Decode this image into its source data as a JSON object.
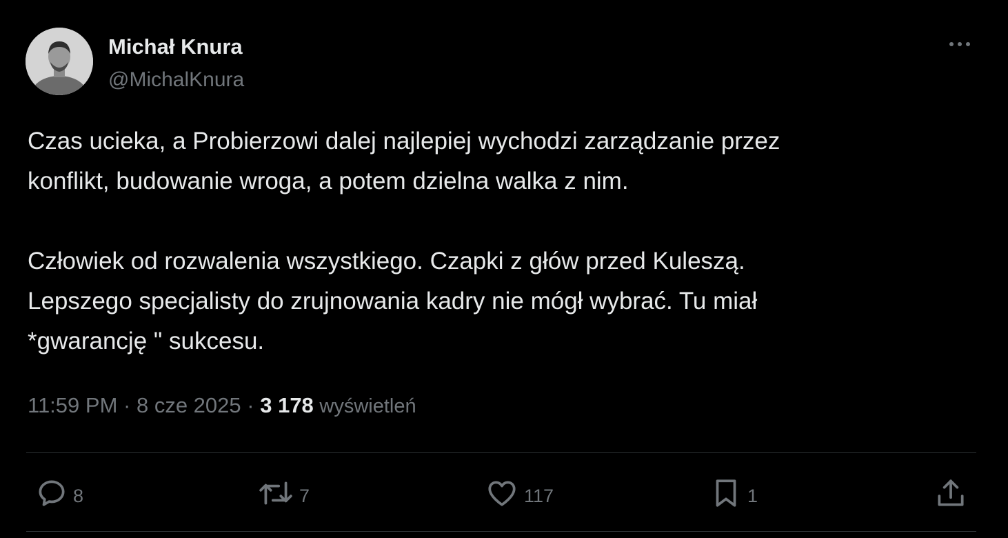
{
  "author": {
    "name": "Michał Knura",
    "handle": "@MichalKnura",
    "avatar_icon": "avatar-photo"
  },
  "tweet": {
    "lines": [
      "Czas ucieka, a Probierzowi dalej najlepiej wychodzi zarządzanie przez",
      "konflikt, budowanie wroga, a potem dzielna walka z nim.",
      "Człowiek od rozwalenia wszystkiego. Czapki z głów przed Kuleszą.",
      "Lepszego specjalisty do zrujnowania kadry nie mógł wybrać. Tu miał",
      "*gwarancję \" sukcesu."
    ]
  },
  "meta": {
    "time": "11:59 PM",
    "separator": "·",
    "date": "8 cze 2025",
    "views_count": "3 178",
    "views_label": "wyświetleń"
  },
  "actions": {
    "replies": "8",
    "reposts": "7",
    "likes": "117",
    "bookmarks": "1"
  },
  "icons": {
    "more": "more-horizontal-icon",
    "reply": "reply-icon",
    "repost": "repost-icon",
    "like": "heart-icon",
    "bookmark": "bookmark-icon",
    "share": "share-icon"
  },
  "colors": {
    "background": "#000000",
    "text_primary": "#e7e9ea",
    "text_secondary": "#71767b",
    "divider": "#2f3336"
  }
}
